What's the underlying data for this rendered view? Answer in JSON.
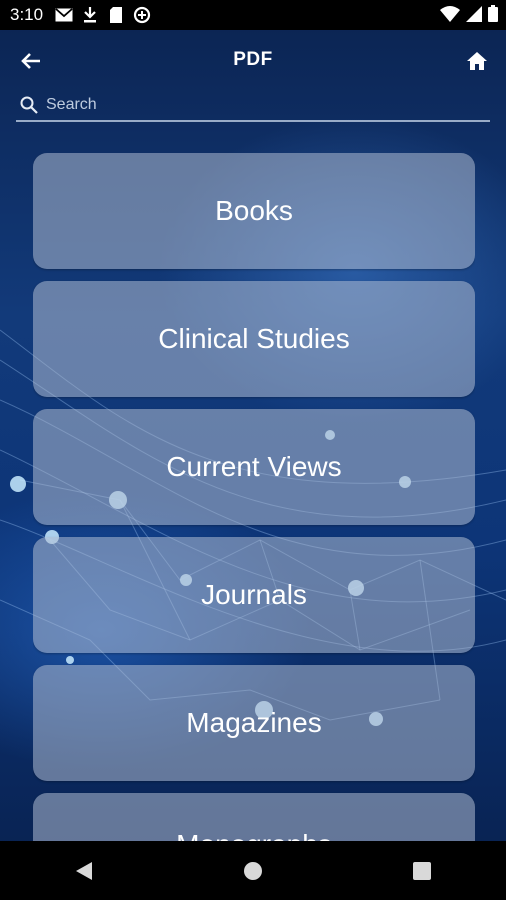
{
  "status_bar": {
    "time": "3:10",
    "left_icons": [
      "gmail-icon",
      "download-icon",
      "sd-card-icon",
      "data-saver-icon"
    ],
    "right_icons": [
      "wifi-icon",
      "signal-icon",
      "battery-icon"
    ]
  },
  "app_bar": {
    "title": "PDF",
    "back_icon": "arrow-left-icon",
    "home_icon": "home-icon"
  },
  "search": {
    "placeholder": "Search",
    "value": ""
  },
  "menu": {
    "items": [
      {
        "label": "Books"
      },
      {
        "label": "Clinical Studies"
      },
      {
        "label": "Current Views"
      },
      {
        "label": "Journals"
      },
      {
        "label": "Magazines"
      },
      {
        "label": "Monographs"
      }
    ]
  },
  "nav_bar": {
    "icons": [
      "back-triangle-icon",
      "home-circle-icon",
      "recents-square-icon"
    ]
  },
  "colors": {
    "status_bar": "#000000",
    "background": "#0d3578",
    "button_fill": "#afbcd2",
    "text": "#ffffff"
  }
}
